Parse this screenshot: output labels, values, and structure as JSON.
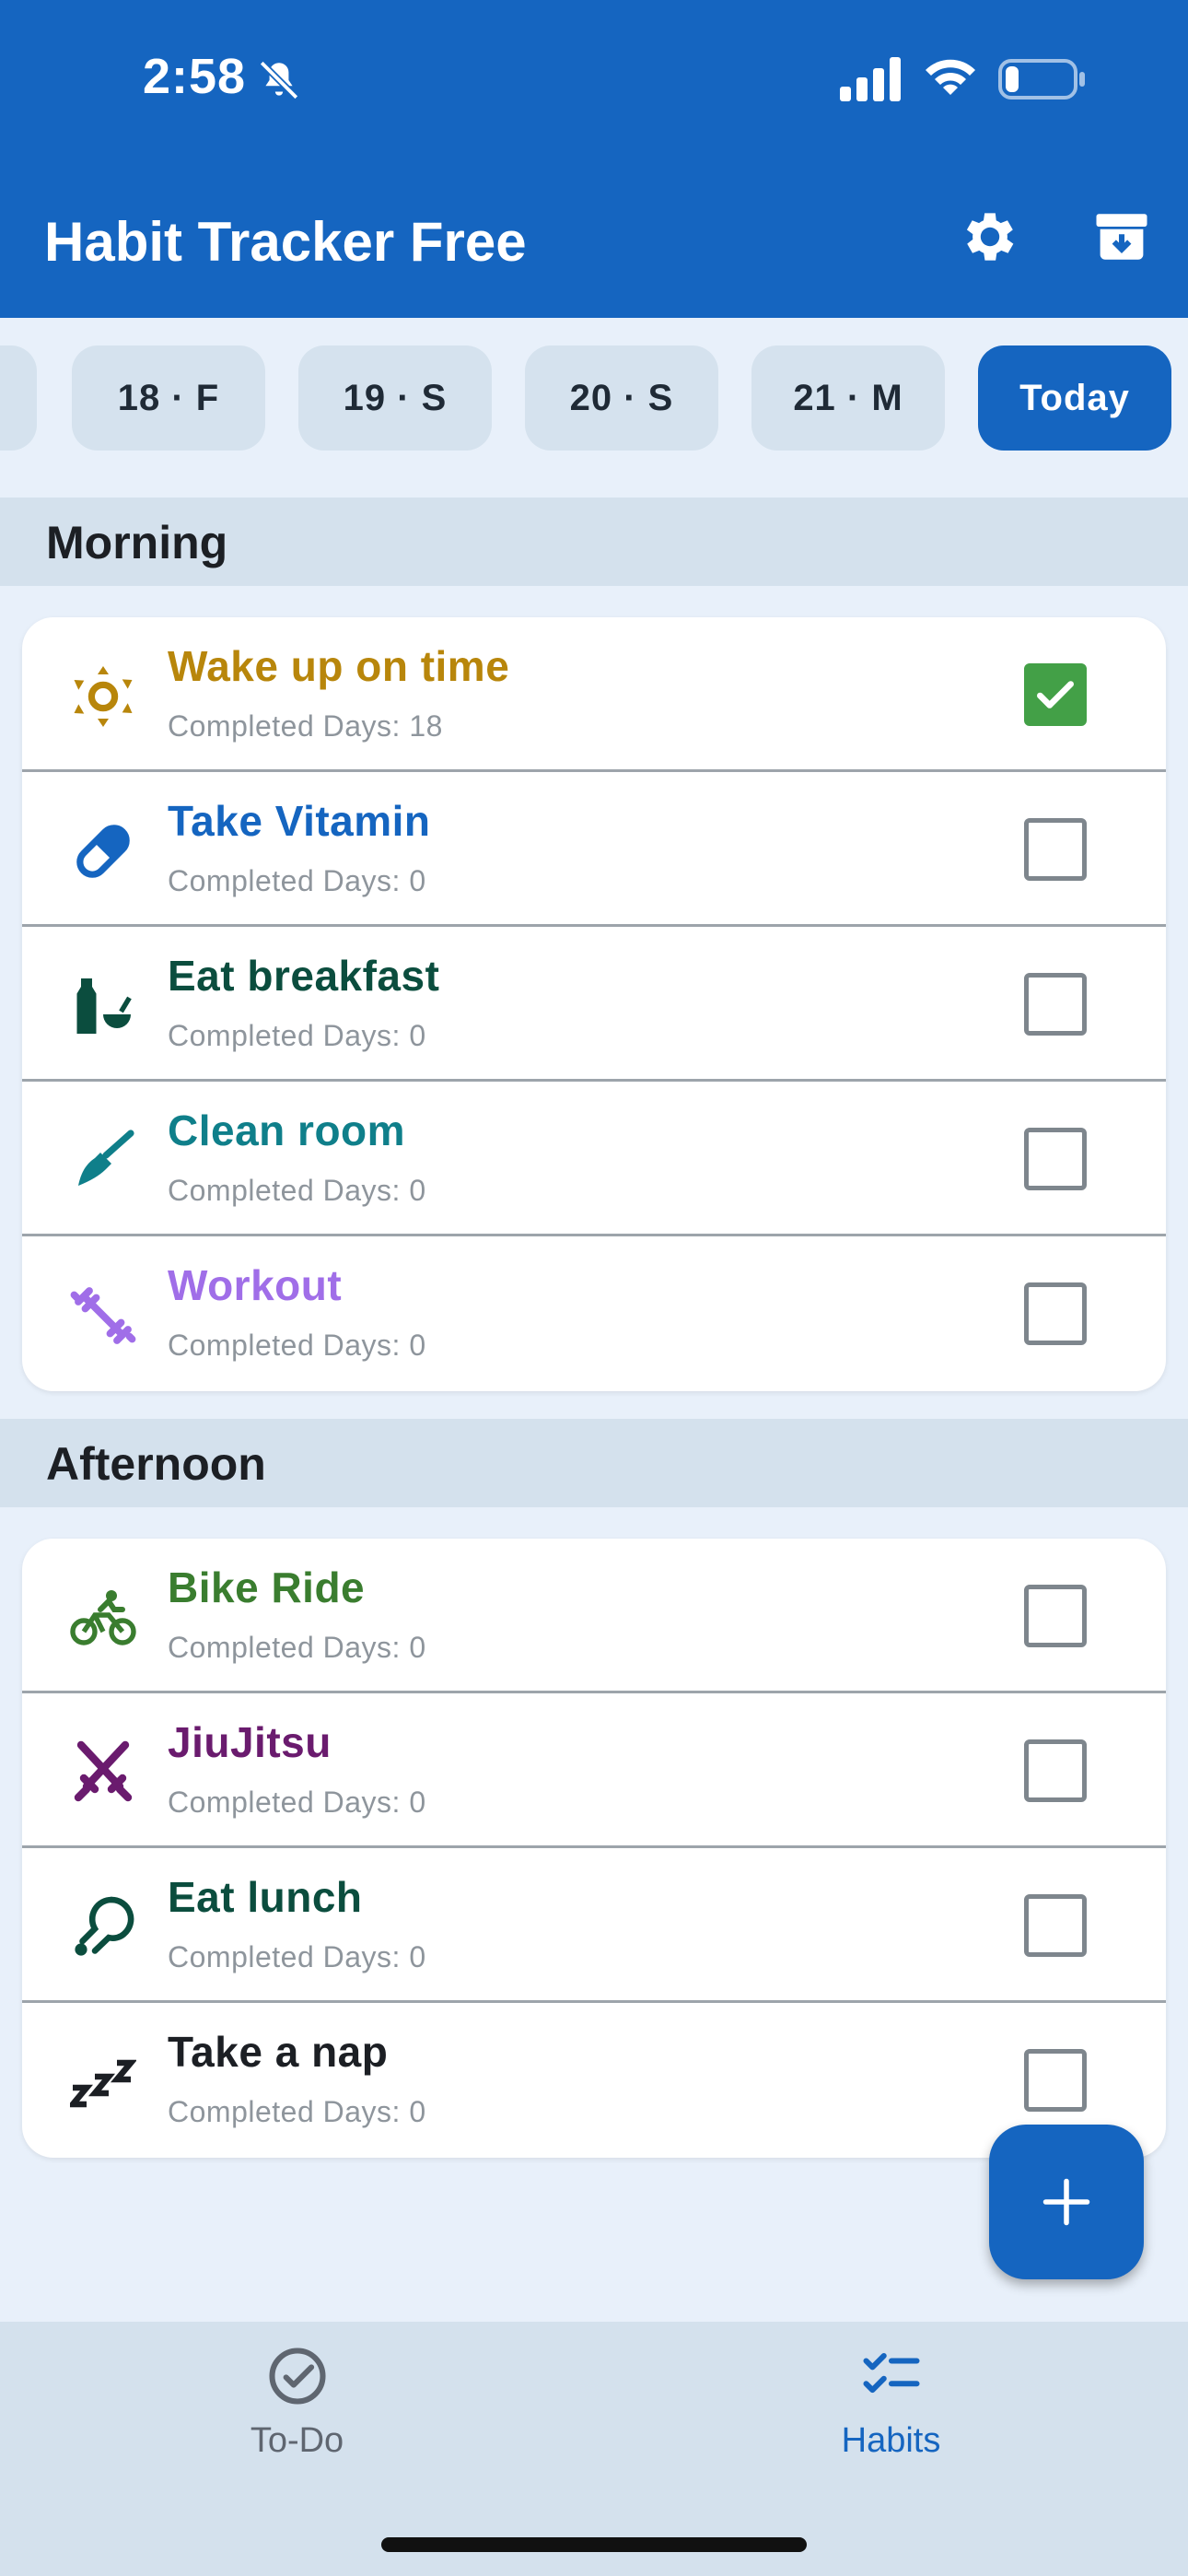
{
  "status_bar": {
    "time": "2:58"
  },
  "app": {
    "title": "Habit Tracker Free"
  },
  "dates": [
    {
      "label": "18 · F",
      "active": false
    },
    {
      "label": "19 · S",
      "active": false
    },
    {
      "label": "20 · S",
      "active": false
    },
    {
      "label": "21 · M",
      "active": false
    },
    {
      "label": "Today",
      "active": true
    }
  ],
  "sections": [
    {
      "title": "Morning",
      "habits": [
        {
          "name": "Wake up on time",
          "sub": "Completed Days: 18",
          "color": "#b8860b",
          "icon": "sun-icon",
          "checked": true
        },
        {
          "name": "Take Vitamin",
          "sub": "Completed Days: 0",
          "color": "#1565c0",
          "icon": "pill-icon",
          "checked": false
        },
        {
          "name": "Eat breakfast",
          "sub": "Completed Days: 0",
          "color": "#0b4d3e",
          "icon": "bottle-bowl-icon",
          "checked": false
        },
        {
          "name": "Clean room",
          "sub": "Completed Days: 0",
          "color": "#0f7f8a",
          "icon": "broom-icon",
          "checked": false
        },
        {
          "name": "Workout",
          "sub": "Completed Days: 0",
          "color": "#a06ee8",
          "icon": "dumbbell-icon",
          "checked": false
        }
      ]
    },
    {
      "title": "Afternoon",
      "habits": [
        {
          "name": "Bike Ride",
          "sub": "Completed Days: 0",
          "color": "#3a7d2f",
          "icon": "bike-icon",
          "checked": false
        },
        {
          "name": "JiuJitsu",
          "sub": "Completed Days: 0",
          "color": "#6a1b6e",
          "icon": "crossed-swords-icon",
          "checked": false
        },
        {
          "name": "Eat lunch",
          "sub": "Completed Days: 0",
          "color": "#0b4d3e",
          "icon": "drumstick-icon",
          "checked": false
        },
        {
          "name": "Take a nap",
          "sub": "Completed Days: 0",
          "color": "#1c1f24",
          "icon": "zzz-icon",
          "checked": false
        }
      ]
    }
  ],
  "nav": {
    "todo_label": "To-Do",
    "habits_label": "Habits",
    "active_color": "#1565c0",
    "inactive_color": "#5f6670"
  }
}
